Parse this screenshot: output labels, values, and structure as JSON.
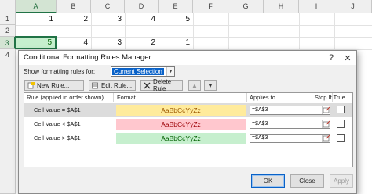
{
  "sheet": {
    "columns": [
      "A",
      "B",
      "C",
      "D",
      "E",
      "F",
      "G",
      "H",
      "I",
      "J"
    ],
    "rows": [
      "1",
      "2",
      "3",
      "4"
    ],
    "cells": {
      "r1": [
        "1",
        "2",
        "3",
        "4",
        "5"
      ],
      "r3": [
        "5",
        "4",
        "3",
        "2",
        "1"
      ]
    }
  },
  "dialog": {
    "title": "Conditional Formatting Rules Manager",
    "help": "?",
    "close": "✕",
    "show_label": "Show formatting rules for:",
    "show_value": "Current Selection",
    "buttons": {
      "new_rule": "New Rule...",
      "edit_rule": "Edit Rule...",
      "delete_rule": "Delete Rule",
      "move_up": "▲",
      "move_down": "▼"
    },
    "headers": {
      "rule": "Rule (applied in order shown)",
      "format": "Format",
      "applies_to": "Applies to",
      "stop_if_true": "Stop If True"
    },
    "rules": [
      {
        "label": "Cell Value = $A$1",
        "preview": "AaBbCcYyZz",
        "fill": "#ffeb9c",
        "font": "#9c5700",
        "applies": "=$A$3",
        "stop": false
      },
      {
        "label": "Cell Value < $A$1",
        "preview": "AaBbCcYyZz",
        "fill": "#ffc7ce",
        "font": "#9c0006",
        "applies": "=$A$3",
        "stop": false
      },
      {
        "label": "Cell Value > $A$1",
        "preview": "AaBbCcYyZz",
        "fill": "#c6efce",
        "font": "#006100",
        "applies": "=$A$3",
        "stop": false
      }
    ],
    "footer": {
      "ok": "OK",
      "close": "Close",
      "apply": "Apply"
    }
  },
  "colors": {
    "excel_green": "#217346",
    "selection_blue": "#0a62c8"
  }
}
